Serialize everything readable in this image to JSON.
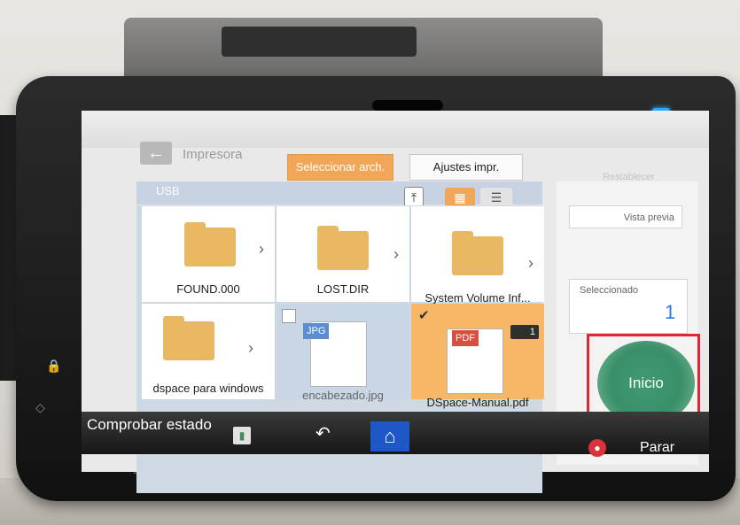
{
  "header": {
    "app_title": "Impresora",
    "back_label": "←",
    "tabs": [
      {
        "label": "Seleccionar arch.",
        "active": true
      },
      {
        "label": "Ajustes impr.",
        "active": false
      }
    ],
    "reset_label": "Restablecer"
  },
  "browser": {
    "location": "USB",
    "view_mode": "grid",
    "items": [
      {
        "name": "FOUND.000",
        "type": "folder",
        "selected": false
      },
      {
        "name": "LOST.DIR",
        "type": "folder",
        "selected": false
      },
      {
        "name": "System Volume Inf...",
        "type": "folder",
        "selected": false
      },
      {
        "name": "dspace para windows",
        "type": "folder",
        "selected": false
      },
      {
        "name": "encabezado.jpg",
        "type": "jpg",
        "badge": "JPG",
        "selected": false
      },
      {
        "name": "DSpace-Manual.pdf",
        "type": "pdf",
        "badge": "PDF",
        "selected": true,
        "copies": "1"
      }
    ]
  },
  "side_panel": {
    "preview_label": "Vista previa",
    "selected_label": "Seleccionado",
    "selected_count": "1",
    "start_label": "Inicio"
  },
  "footer": {
    "status_label": "Comprobar estado",
    "stop_label": "Parar"
  },
  "colors": {
    "accent_orange": "#f2a758",
    "start_green": "#3a8f69",
    "home_blue": "#1e58c8",
    "highlight_red": "#e22732"
  }
}
